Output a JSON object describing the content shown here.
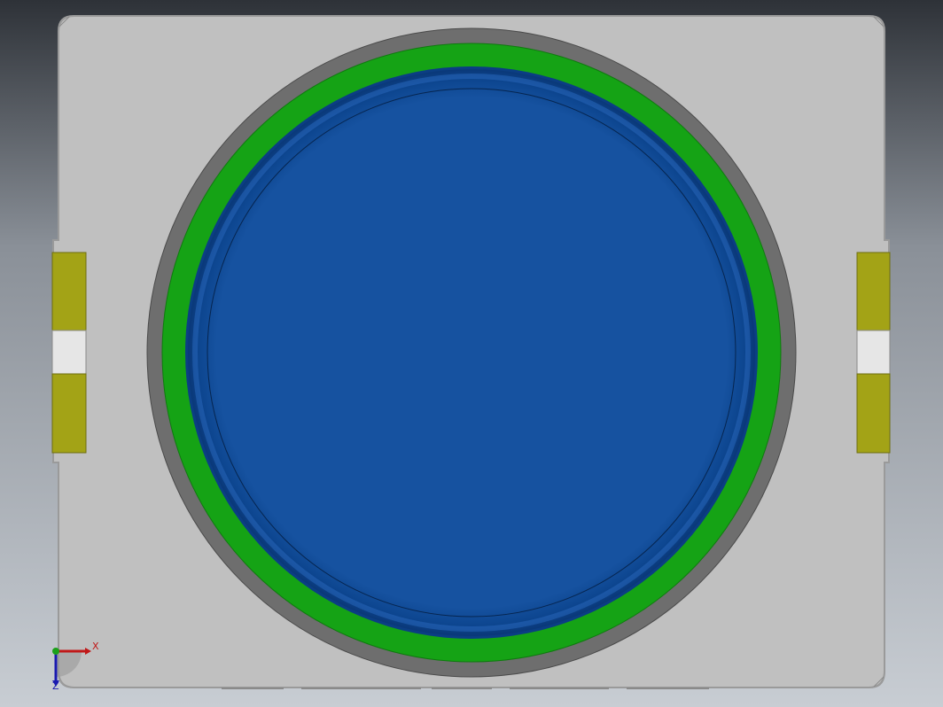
{
  "viewport": {
    "background_top": "#2e3238",
    "background_bottom": "#c8cdd3"
  },
  "part": {
    "body_color": "#c0c0c0",
    "outer_ring_color": "#6e6e6e",
    "seal_ring_color": "#15a315",
    "membrane_color": "#1652a0",
    "membrane_edge_color": "#0b3e84",
    "terminal_color": "#a3a316"
  },
  "triad": {
    "x_label": "X",
    "z_label": "Z",
    "x_color": "#c01818",
    "y_color": "#1aa01a",
    "z_color": "#1a1ab0"
  }
}
